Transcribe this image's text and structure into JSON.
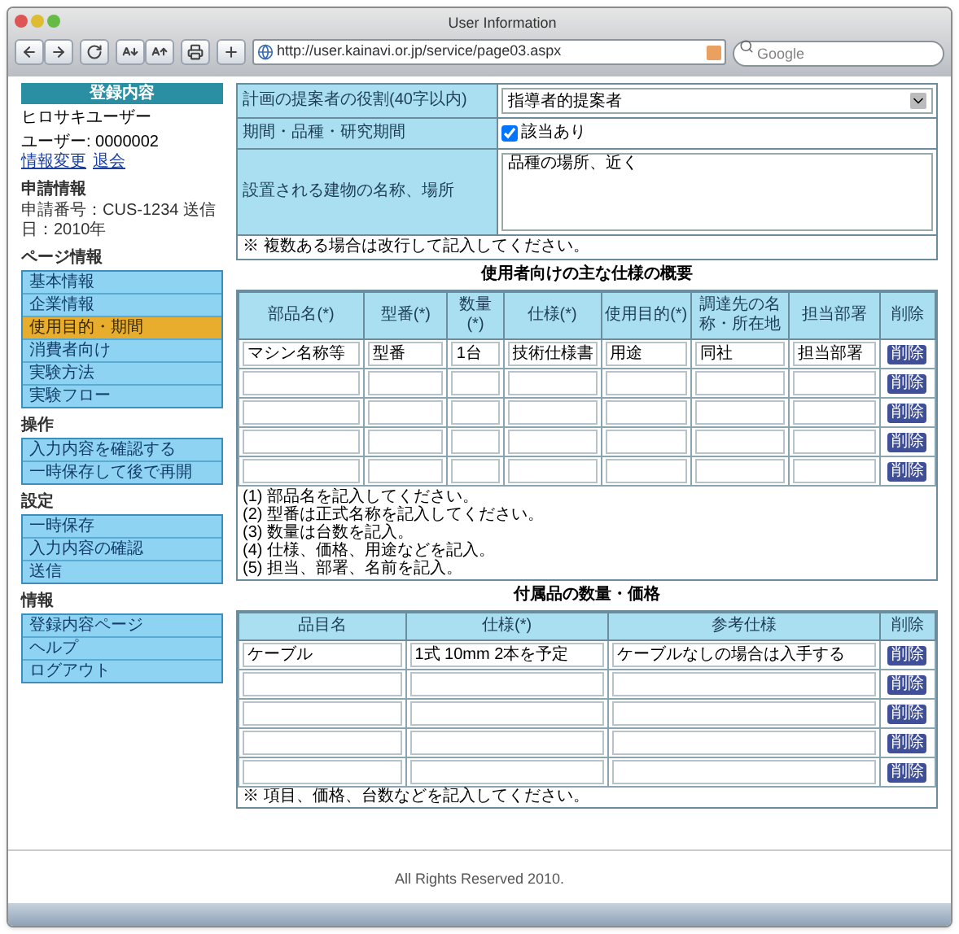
{
  "window": {
    "title": "User Information"
  },
  "toolbar": {
    "url": "http://user.kainavi.or.jp/service/page03.aspx",
    "search": {
      "placeholder": "Google"
    }
  },
  "sidebar": {
    "header": "登録内容",
    "user_name": "ヒロサキユーザー",
    "user_id": "ユーザー: 0000002",
    "user_links": [
      "情報変更",
      "退会"
    ],
    "sections": [
      {
        "title": "申請情報",
        "text": "申請番号：CUS-1234 送信日：2010年"
      },
      {
        "title": "ページ情報",
        "items": [
          {
            "label": "基本情報",
            "selected": false
          },
          {
            "label": "企業情報",
            "selected": false
          },
          {
            "label": "使用目的・期間",
            "selected": true
          },
          {
            "label": "消費者向け",
            "selected": false
          },
          {
            "label": "実験方法",
            "selected": false
          },
          {
            "label": "実験フロー",
            "selected": false
          }
        ]
      },
      {
        "title": "操作",
        "items": [
          {
            "label": "入力内容を確認する",
            "selected": false
          },
          {
            "label": "一時保存して後で再開",
            "selected": false
          }
        ]
      },
      {
        "title": "設定",
        "items": [
          {
            "label": "一時保存",
            "selected": false
          },
          {
            "label": "入力内容の確認",
            "selected": false
          },
          {
            "label": "送信",
            "selected": false
          }
        ]
      },
      {
        "title": "情報",
        "items": [
          {
            "label": "登録内容ページ",
            "selected": false
          },
          {
            "label": "ヘルプ",
            "selected": false
          },
          {
            "label": "ログアウト",
            "selected": false
          }
        ]
      }
    ]
  },
  "main": {
    "form": [
      {
        "kind": "select",
        "label": "計画の提案者の役割(40字以内)",
        "value": "指導者的提案者"
      },
      {
        "kind": "checkbox",
        "label": "期間・品種・研究期間",
        "value": "該当あり",
        "checked": true
      },
      {
        "kind": "textarea",
        "label": "設置される建物の名称、場所",
        "value": "品種の場所、近く"
      }
    ],
    "form_note": "※ 複数ある場合は改行して記入してください。",
    "parts_table": {
      "title": "使用者向けの主な仕様の概要",
      "columns": [
        "部品名(*)",
        "型番(*)",
        "数量(*)",
        "仕様(*)",
        "使用目的(*)",
        "調達先の名称・所在地",
        "担当部署",
        "削除"
      ],
      "rows": [
        {
          "cells": [
            "マシン名称等",
            "型番",
            "1台",
            "技術仕様書",
            "用途",
            "同社",
            "担当部署"
          ],
          "action": "削除"
        },
        {
          "action": "削除"
        },
        {
          "action": "削除"
        },
        {
          "action": "削除"
        },
        {
          "action": "削除"
        }
      ],
      "notes": [
        "(1) 部品名を記入してください。",
        "(2) 型番は正式名称を記入してください。",
        "(3) 数量は台数を記入。",
        "(4) 仕様、価格、用途などを記入。",
        "(5) 担当、部署、名前を記入。"
      ]
    },
    "accessory_table": {
      "title": "付属品の数量・価格",
      "columns": [
        "品目名",
        "仕様(*)",
        "参考仕様",
        "削除"
      ],
      "rows": [
        {
          "cells": [
            "ケーブル",
            "1式 10mm 2本を予定",
            "ケーブルなしの場合は入手する"
          ],
          "action": "削除"
        },
        {
          "action": "削除"
        },
        {
          "action": "削除"
        },
        {
          "action": "削除"
        },
        {
          "action": "削除"
        }
      ],
      "note": "※ 項目、価格、台数などを記入してください。"
    }
  },
  "footer": "All Rights Reserved 2010."
}
